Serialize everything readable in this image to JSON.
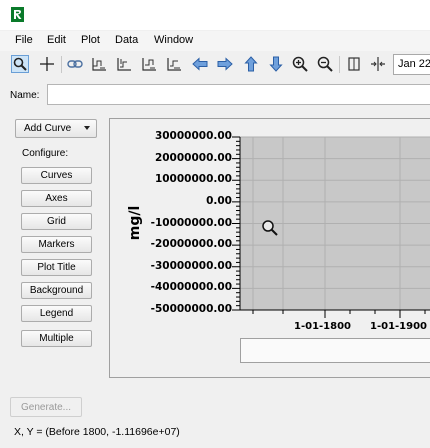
{
  "colors": {
    "plot_bg": "#c8c8c8",
    "grid": "#b0b0b0",
    "accent": "#0a7a2a",
    "toolbar_active": "#cde4f7"
  },
  "app": {
    "logo_icon": "tstool-logo-icon"
  },
  "menu": [
    "File",
    "Edit",
    "Plot",
    "Data",
    "Window"
  ],
  "toolbar": {
    "icons": [
      "zoom-mode-icon",
      "crosshair-icon",
      "link-icon",
      "graph-x-icon",
      "graph-y-icon",
      "graph-xy-icon",
      "graph-data-icon",
      "arrow-left-icon",
      "arrow-right-icon",
      "arrow-up-icon",
      "arrow-down-icon",
      "zoom-in-icon",
      "zoom-out-icon",
      "fit-icon",
      "center-icon"
    ],
    "date_value": "Jan 22"
  },
  "name_field": {
    "label": "Name:",
    "value": ""
  },
  "left_panel": {
    "add_curve": "Add Curve",
    "configure_label": "Configure:",
    "buttons": [
      "Curves",
      "Axes",
      "Grid",
      "Markers",
      "Plot Title",
      "Background",
      "Legend",
      "Multiple"
    ]
  },
  "chart_data": {
    "type": "line",
    "ylabel": "mg/l",
    "y_ticks": [
      "30000000.00",
      "20000000.00",
      "10000000.00",
      "0.00",
      "-10000000.00",
      "-20000000.00",
      "-30000000.00",
      "-40000000.00",
      "-50000000.00"
    ],
    "ylim": [
      -50000000,
      30000000
    ],
    "x_ticks": [
      "1-01-1800",
      "1-01-1900"
    ],
    "grid": true,
    "series": []
  },
  "generate_label": "Generate...",
  "status_text": "X, Y = (Before 1800, -1.11696e+07)"
}
